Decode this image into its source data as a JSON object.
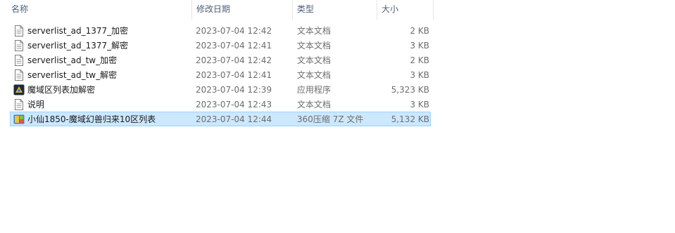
{
  "columns": {
    "name": "名称",
    "date": "修改日期",
    "type": "类型",
    "size": "大小"
  },
  "files": [
    {
      "name": "serverlist_ad_1377_加密",
      "date": "2023-07-04 12:42",
      "type": "文本文档",
      "size": "2 KB",
      "icon": "text-file-icon"
    },
    {
      "name": "serverlist_ad_1377_解密",
      "date": "2023-07-04 12:41",
      "type": "文本文档",
      "size": "3 KB",
      "icon": "text-file-icon"
    },
    {
      "name": "serverlist_ad_tw_加密",
      "date": "2023-07-04 12:42",
      "type": "文本文档",
      "size": "2 KB",
      "icon": "text-file-icon"
    },
    {
      "name": "serverlist_ad_tw_解密",
      "date": "2023-07-04 12:41",
      "type": "文本文档",
      "size": "3 KB",
      "icon": "text-file-icon"
    },
    {
      "name": "魔域区列表加解密",
      "date": "2023-07-04 12:39",
      "type": "应用程序",
      "size": "5,323 KB",
      "icon": "application-icon"
    },
    {
      "name": "说明",
      "date": "2023-07-04 12:43",
      "type": "文本文档",
      "size": "3 KB",
      "icon": "text-file-icon"
    },
    {
      "name": "小仙1850-魔域幻兽归来10区列表",
      "date": "2023-07-04 12:44",
      "type": "360压缩 7Z 文件",
      "size": "5,132 KB",
      "icon": "archive-icon"
    }
  ],
  "colors": {
    "selection_bg": "#cce8ff",
    "selection_border": "#99d1ff",
    "header_text": "#4c607a"
  }
}
